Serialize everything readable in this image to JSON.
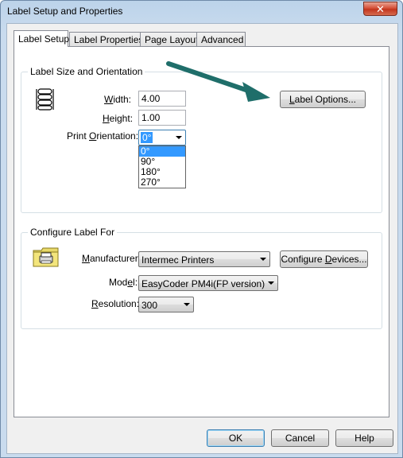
{
  "window": {
    "title": "Label Setup and Properties",
    "close_glyph": "✕"
  },
  "tabs": [
    {
      "label": "Label Setup",
      "active": true
    },
    {
      "label": "Label Properties",
      "active": false
    },
    {
      "label": "Page Layout",
      "active": false
    },
    {
      "label": "Advanced",
      "active": false
    }
  ],
  "size_group": {
    "title": "Label Size and Orientation",
    "width_label_pre": "",
    "width_label_u": "W",
    "width_label_post": "idth:",
    "width_value": "4.00",
    "height_label_pre": "",
    "height_label_u": "H",
    "height_label_post": "eight:",
    "height_value": "1.00",
    "orientation_label_pre": "Print ",
    "orientation_label_u": "O",
    "orientation_label_post": "rientation:",
    "orientation_value": "0°",
    "orientation_options": [
      "0°",
      "90°",
      "180°",
      "270°"
    ],
    "label_options_u": "L",
    "label_options_rest": "abel Options...",
    "icon": "label-stack-icon"
  },
  "configure_group": {
    "title": "Configure Label For",
    "manufacturer_label_pre": "",
    "manufacturer_label_u": "M",
    "manufacturer_label_post": "anufacturer:",
    "manufacturer_value": "Intermec Printers",
    "configure_devices_pre": "Configure ",
    "configure_devices_u": "D",
    "configure_devices_post": "evices...",
    "model_label_pre": "Mod",
    "model_label_u": "e",
    "model_label_post": "l:",
    "model_value": "EasyCoder PM4i(FP version)",
    "resolution_label_pre": "",
    "resolution_label_u": "R",
    "resolution_label_post": "esolution:",
    "resolution_value": "300",
    "icon": "printer-folder-icon"
  },
  "buttons": {
    "ok": "OK",
    "cancel": "Cancel",
    "help": "Help"
  },
  "colors": {
    "annotation_arrow": "#1f6e6a",
    "selection": "#3399ff"
  }
}
